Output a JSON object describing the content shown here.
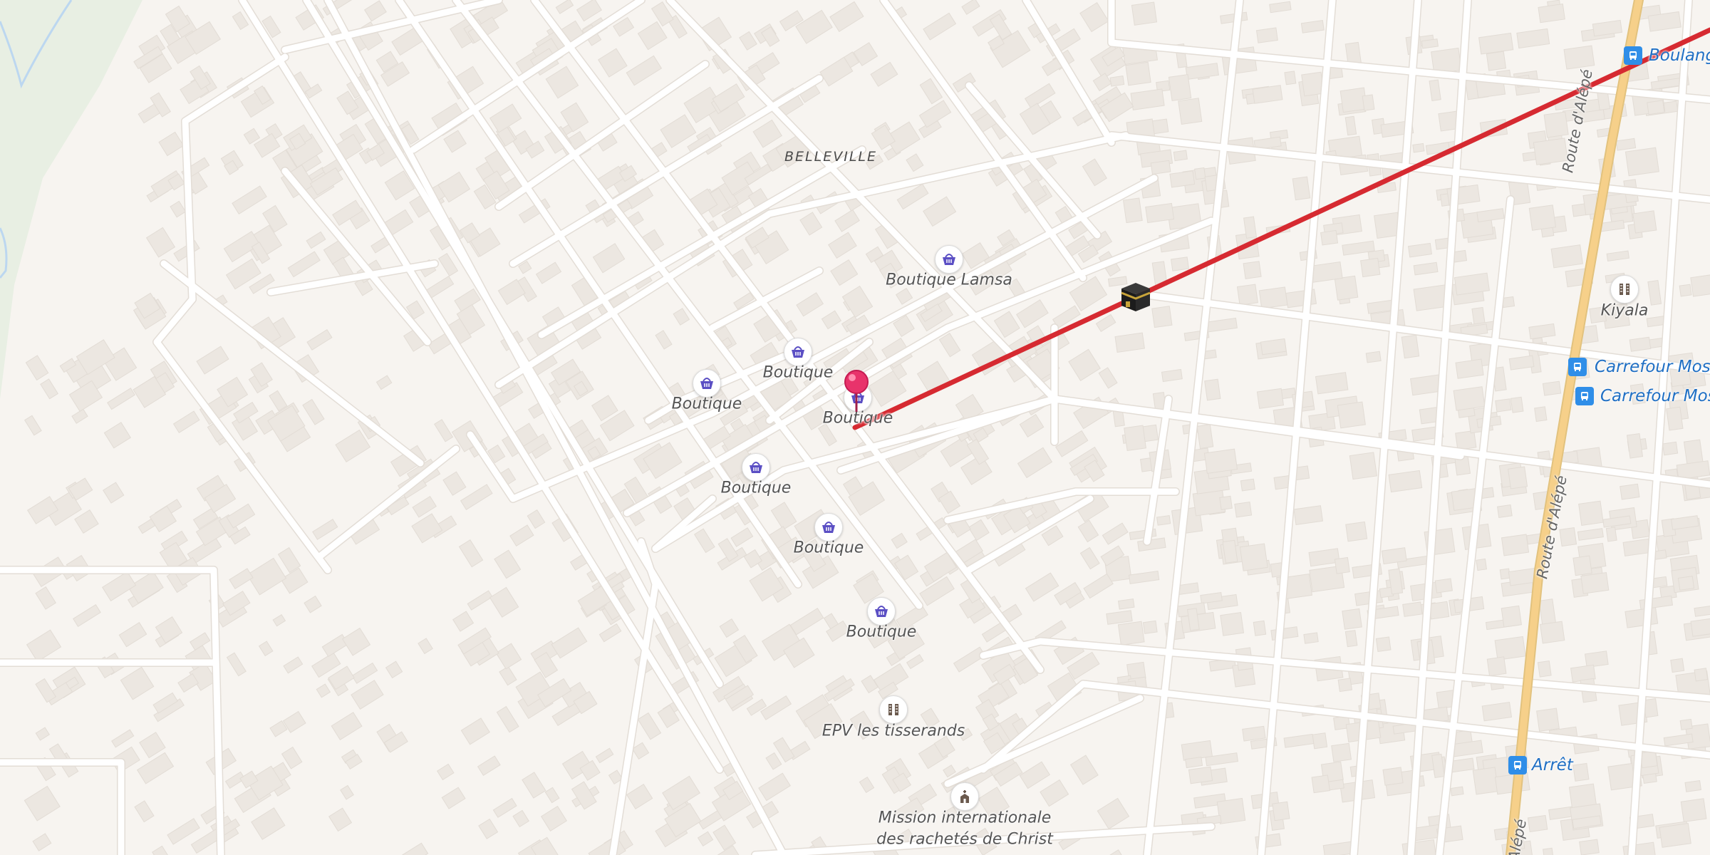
{
  "map": {
    "district": "BELLEVILLE",
    "colors": {
      "background": "#f7f4f0",
      "park": "#e8efe3",
      "water": "#bcd7f0",
      "road": "#ffffff",
      "main_road": "#f6d08a",
      "building": "#ece7e1",
      "route_line": "#d62a31",
      "poi_shop": "#5b4fc4",
      "bus_stop": "#2f8ee8",
      "pin": "#e8336b"
    },
    "pois": [
      {
        "label": "Boutique Lamsa",
        "icon": "shopping-basket-icon"
      },
      {
        "label": "Boutique",
        "icon": "shopping-basket-icon"
      },
      {
        "label": "Boutique",
        "icon": "shopping-basket-icon"
      },
      {
        "label": "Boutique",
        "icon": "shopping-basket-icon"
      },
      {
        "label": "Boutique",
        "icon": "shopping-basket-icon"
      },
      {
        "label": "Boutique",
        "icon": "shopping-basket-icon"
      },
      {
        "label": "Boutique",
        "icon": "shopping-basket-icon"
      },
      {
        "label": "EPV les tisserands",
        "icon": "school-icon"
      },
      {
        "label": "Kiyala",
        "icon": "school-icon"
      }
    ],
    "mission": {
      "line1": "Mission internationale",
      "line2": "des rachetés de Christ",
      "icon": "church-icon"
    },
    "bus_stops": [
      {
        "label": "Boulang",
        "icon": "bus-stop-icon"
      },
      {
        "label": "Carrefour Mosq",
        "icon": "bus-stop-icon"
      },
      {
        "label": "Carrefour Mosq",
        "icon": "bus-stop-icon"
      },
      {
        "label": "Arrêt",
        "icon": "bus-stop-icon"
      }
    ],
    "roads": {
      "main": "Route d'Alépé",
      "main_upper": "Route d'Alépé",
      "main_lower": "Alépé"
    },
    "markers": {
      "start_pin": "location-pin-icon",
      "destination": "kaaba-icon"
    }
  }
}
